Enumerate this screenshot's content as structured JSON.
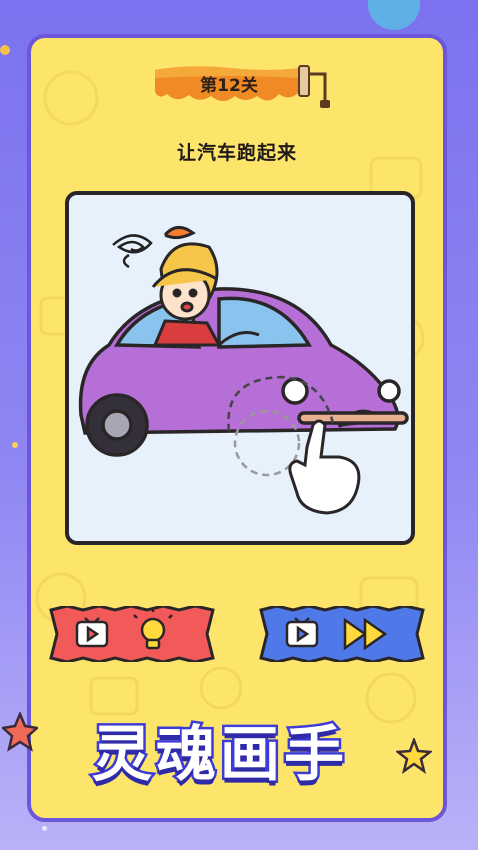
{
  "level": {
    "label": "第12关"
  },
  "task": {
    "title": "让汽车跑起来"
  },
  "buttons": {
    "hint": {
      "icons": [
        "tv-icon",
        "lightbulb-icon"
      ],
      "color": "#f25a5a"
    },
    "skip": {
      "icons": [
        "tv-icon",
        "fast-forward-icon"
      ],
      "color": "#4f79e8"
    }
  },
  "logo": {
    "text": "灵魂画手"
  },
  "colors": {
    "card": "#fde46b",
    "card_border": "#6c56d9",
    "background": "#7b72ef",
    "car": "#b66fd6"
  }
}
